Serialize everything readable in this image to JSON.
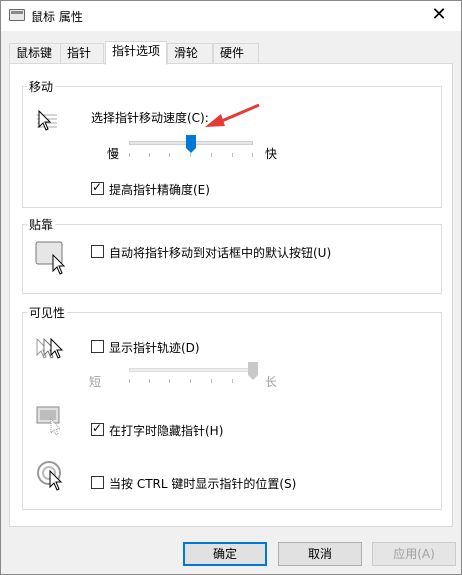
{
  "window": {
    "title": "鼠标 属性",
    "close_glyph": "✕"
  },
  "tabs": [
    {
      "label": "鼠标键"
    },
    {
      "label": "指针"
    },
    {
      "label": "指针选项"
    },
    {
      "label": "滑轮"
    },
    {
      "label": "硬件"
    }
  ],
  "motion": {
    "title": "移动",
    "speed_label": "选择指针移动速度(C):",
    "slow": "慢",
    "fast": "快",
    "speed_level": 0.5,
    "precision_label": "提高指针精确度(E)",
    "precision_checked": true
  },
  "snap": {
    "title": "贴靠",
    "snap_label": "自动将指针移动到对话框中的默认按钮(U)",
    "snap_checked": false
  },
  "visibility": {
    "title": "可见性",
    "trails_label": "显示指针轨迹(D)",
    "trails_checked": false,
    "short": "短",
    "long": "长",
    "trail_level": 1.0,
    "hide_label": "在打字时隐藏指针(H)",
    "hide_checked": true,
    "ctrl_label": "当按 CTRL 键时显示指针的位置(S)",
    "ctrl_checked": false
  },
  "buttons": {
    "ok": "确定",
    "cancel": "取消",
    "apply": "应用(A)"
  },
  "colors": {
    "accent": "#0078d7",
    "annotation_arrow": "#e53935"
  }
}
